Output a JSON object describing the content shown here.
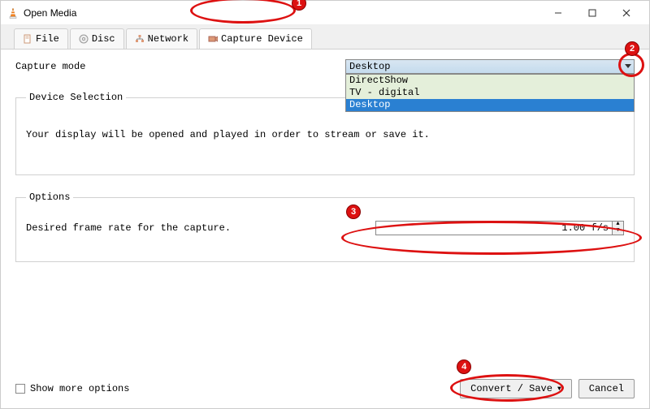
{
  "window": {
    "title": "Open Media"
  },
  "tabs": {
    "file": "File",
    "disc": "Disc",
    "network": "Network",
    "capture": "Capture Device"
  },
  "capture_mode": {
    "label": "Capture mode",
    "value": "Desktop",
    "options": [
      "DirectShow",
      "TV - digital",
      "Desktop"
    ]
  },
  "device_selection": {
    "legend": "Device Selection",
    "description": "Your display will be opened and played in order to stream or save it."
  },
  "options": {
    "legend": "Options",
    "fps_label": "Desired frame rate for the capture.",
    "fps_value": "1.00 f/s"
  },
  "footer": {
    "show_more": "Show more options",
    "convert": "Convert / Save",
    "cancel": "Cancel"
  },
  "annotations": {
    "b1": "1",
    "b2": "2",
    "b3": "3",
    "b4": "4"
  }
}
